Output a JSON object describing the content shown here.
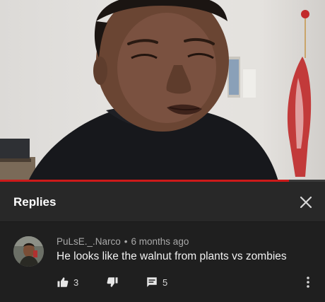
{
  "video": {
    "progress_fraction": 0.89,
    "progress_color": "#cc1a1a"
  },
  "panel": {
    "title": "Replies",
    "close_icon": "close-icon"
  },
  "comment": {
    "author": "PuLsE._.Narco",
    "separator": "•",
    "time": "6 months ago",
    "text": "He looks like the walnut from plants vs zombies",
    "likes": "3",
    "replies": "5",
    "icons": {
      "like": "thumb-up-icon",
      "dislike": "thumb-down-icon",
      "reply": "comment-icon",
      "more": "more-vert-icon"
    }
  },
  "colors": {
    "panel_bg": "#1f1f1f",
    "header_bg": "#282828",
    "meta_text": "#a9a9a9",
    "body_text": "#f1f1f1"
  }
}
